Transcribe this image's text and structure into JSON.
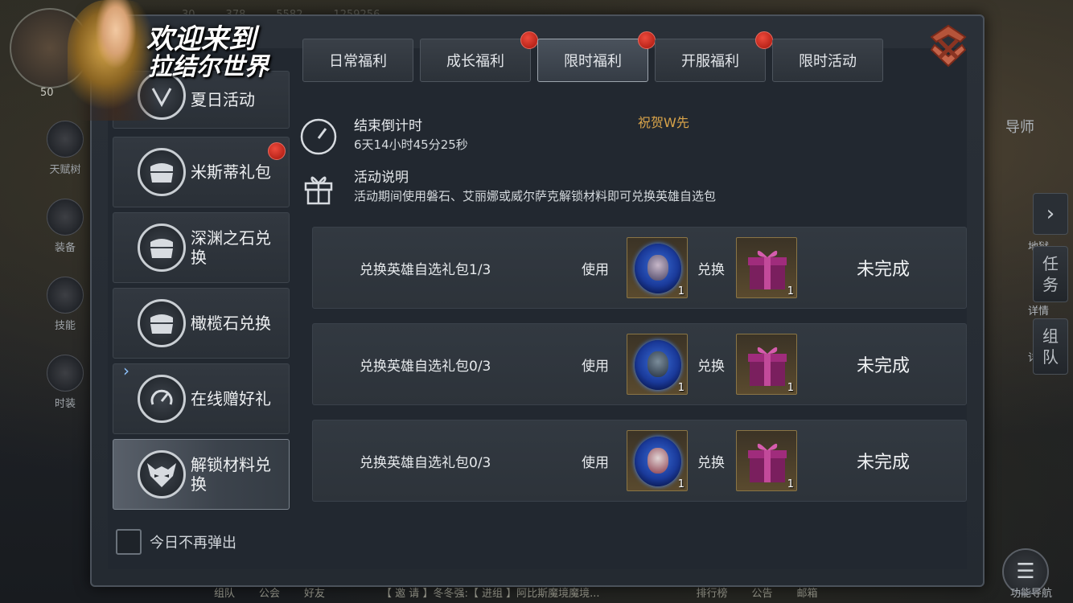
{
  "welcome": {
    "line1": "欢迎来到",
    "line2": "拉结尔世界"
  },
  "tabs": [
    {
      "label": "日常福利",
      "badge": false,
      "active": false
    },
    {
      "label": "成长福利",
      "badge": true,
      "active": false
    },
    {
      "label": "限时福利",
      "badge": true,
      "active": true
    },
    {
      "label": "开服福利",
      "badge": true,
      "active": false
    },
    {
      "label": "限时活动",
      "badge": false,
      "active": false
    }
  ],
  "nav": [
    {
      "label": "夏日活动",
      "icon": "summer-event-icon",
      "badge": false,
      "active": false
    },
    {
      "label": "米斯蒂礼包",
      "icon": "chest-icon",
      "badge": true,
      "active": false
    },
    {
      "label": "深渊之石兑换",
      "icon": "chest-icon",
      "badge": false,
      "active": false
    },
    {
      "label": "橄榄石兑换",
      "icon": "chest-icon",
      "badge": false,
      "active": false
    },
    {
      "label": "在线赠好礼",
      "icon": "gauge-icon",
      "badge": false,
      "active": false
    },
    {
      "label": "解锁材料兑换",
      "icon": "demon-mask-icon",
      "badge": false,
      "active": true
    }
  ],
  "countdown": {
    "title": "结束倒计时",
    "value": "6天14小时45分25秒"
  },
  "description": {
    "title": "活动说明",
    "text": "活动期间使用磐石、艾丽娜或威尔萨克解锁材料即可兑换英雄自选包"
  },
  "congrats_ticker": "祝贺W先",
  "exchanges": [
    {
      "name": "兑换英雄自选礼包1/3",
      "use_label": "使用",
      "swap_label": "兑换",
      "cost_qty": "1",
      "reward_qty": "1",
      "status": "未完成"
    },
    {
      "name": "兑换英雄自选礼包0/3",
      "use_label": "使用",
      "swap_label": "兑换",
      "cost_qty": "1",
      "reward_qty": "1",
      "status": "未完成"
    },
    {
      "name": "兑换英雄自选礼包0/3",
      "use_label": "使用",
      "swap_label": "兑换",
      "cost_qty": "1",
      "reward_qty": "1",
      "status": "未完成"
    }
  ],
  "dont_show_today": "今日不再弹出",
  "background": {
    "top_stats": [
      "30",
      "378",
      "5582",
      "1259256"
    ],
    "level": "50",
    "rail": [
      {
        "label": "天赋树"
      },
      {
        "label": "装备"
      },
      {
        "label": "技能"
      },
      {
        "label": "时装"
      }
    ],
    "right_labels": [
      "导师",
      "地狱",
      "详情",
      "详情"
    ],
    "side_tabs": [
      {
        "label": "任务"
      },
      {
        "label": "组队"
      }
    ],
    "chat": "【 邀 请 】冬冬强:【 进组 】阿比斯魔境魔境...",
    "bottom_labels": [
      "组队",
      "公会",
      "好友",
      "排行榜",
      "公告",
      "邮箱"
    ],
    "menu_label": "功能导航"
  },
  "colors": {
    "accent_gold": "#d9a44a",
    "badge_red": "#d22a1c",
    "panel": "#2a3038"
  }
}
